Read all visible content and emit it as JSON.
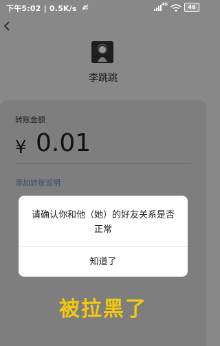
{
  "status_bar": {
    "time_speed": "下午5:02 | 0.5K/s",
    "network": "4G",
    "battery": "46"
  },
  "header": {
    "back_icon": "chevron-left-icon"
  },
  "recipient": {
    "name": "李跳跳"
  },
  "transfer": {
    "amount_label": "转账金额",
    "currency": "¥",
    "amount": "0.01",
    "add_remark": "添加转账说明"
  },
  "dialog": {
    "message": "请确认你和他（她）的好友关系是否正常",
    "button": "知道了"
  },
  "caption": "被拉黑了",
  "colors": {
    "caption": "#f2c80f",
    "link": "#3c4c6e",
    "overlay_bg": "#888888"
  }
}
